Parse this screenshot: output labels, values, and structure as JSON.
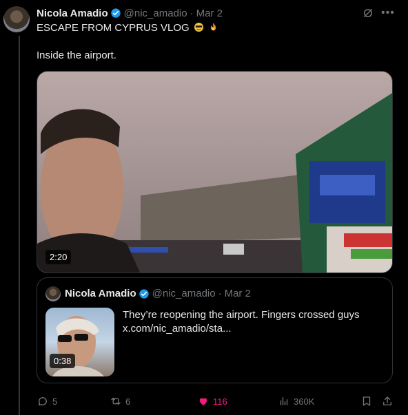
{
  "post": {
    "author_name": "Nicola Amadio",
    "handle": "@nic_amadio",
    "separator": "·",
    "date": "Mar 2",
    "line1": "ESCAPE FROM CYPRUS VLOG",
    "line2": "Inside the airport.",
    "video_duration": "2:20"
  },
  "quote": {
    "author_name": "Nicola Amadio",
    "handle": "@nic_amadio",
    "separator": "·",
    "date": "Mar 2",
    "text_line1": "They’re reopening the airport. Fingers crossed guys",
    "text_line2": "x.com/nic_amadio/sta...",
    "video_duration": "0:38"
  },
  "actions": {
    "replies": "5",
    "reposts": "6",
    "likes": "116",
    "views": "360K"
  },
  "colors": {
    "background": "#000000",
    "text": "#e7e9ea",
    "muted": "#71767b",
    "verified": "#1d9bf0",
    "like": "#f91880",
    "border": "#2f3336"
  }
}
